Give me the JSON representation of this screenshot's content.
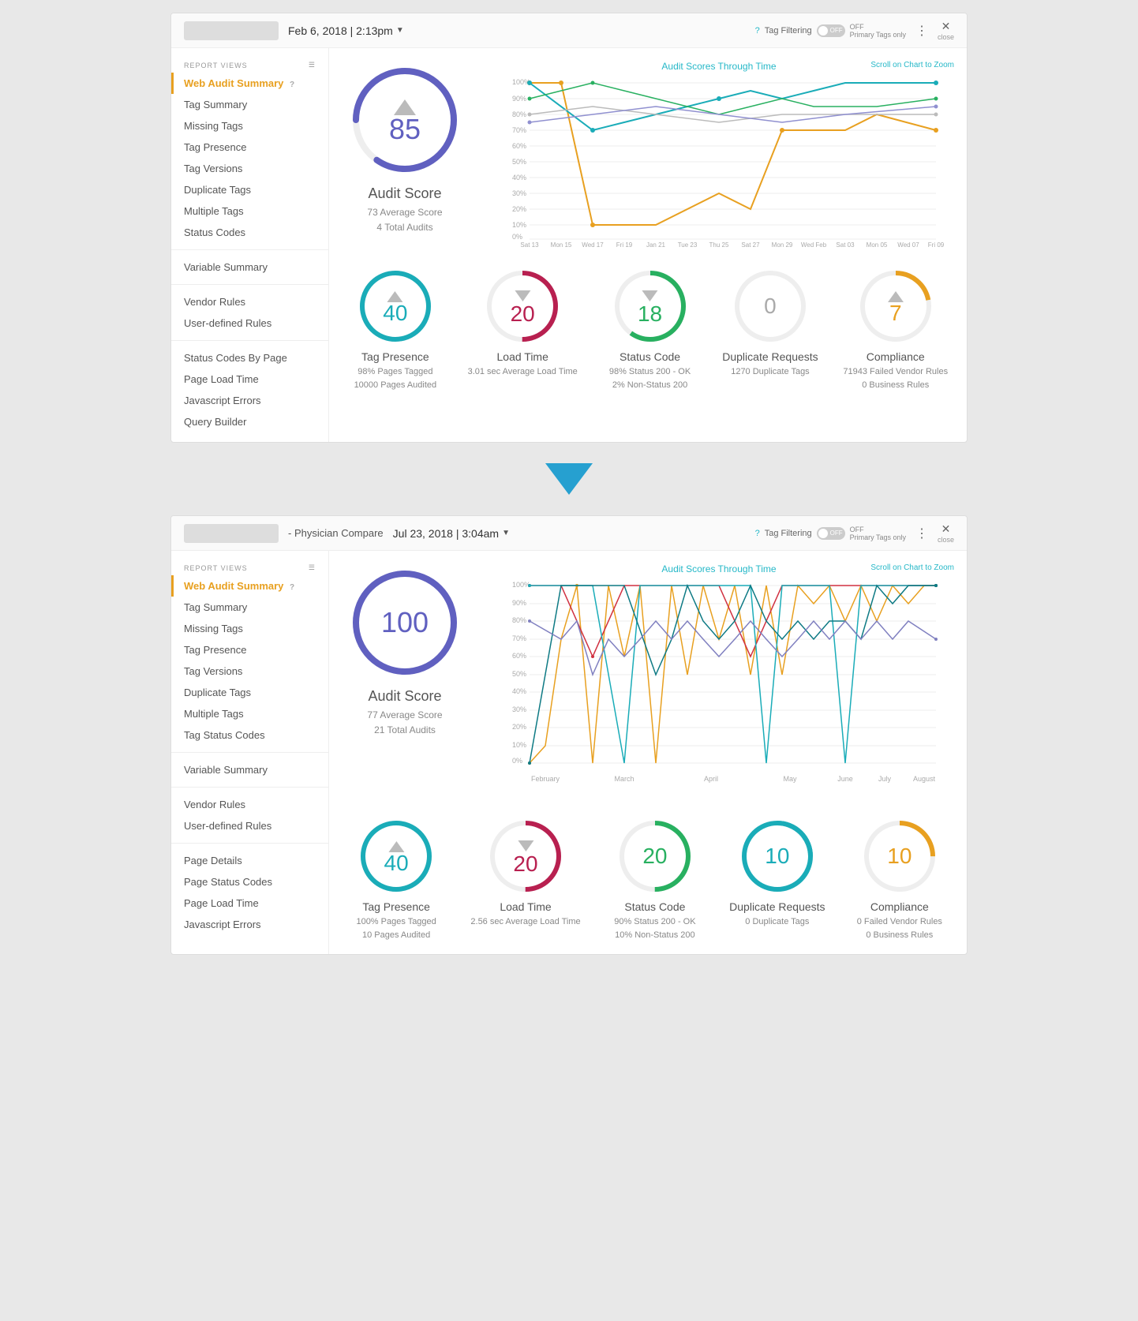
{
  "panel1": {
    "date": "Feb 6, 2018 | 2:13pm",
    "tag_filtering_label": "Tag Filtering",
    "tag_filtering_status": "OFF",
    "tag_filtering_sub": "Primary Tags only",
    "close_label": "close",
    "sidebar": {
      "section_label": "REPORT VIEWS",
      "active_item": "Web Audit Summary",
      "active_item_icon": "?",
      "items": [
        "Tag Summary",
        "Missing Tags",
        "Tag Presence",
        "Tag Versions",
        "Duplicate Tags",
        "Multiple Tags",
        "Status Codes",
        "Variable Summary",
        "Vendor Rules",
        "User-defined Rules",
        "Status Codes By Page",
        "Page Load Time",
        "Javascript Errors",
        "Query Builder"
      ]
    },
    "score": {
      "value": "85",
      "label": "Audit Score",
      "sub1": "73 Average Score",
      "sub2": "4 Total Audits"
    },
    "chart": {
      "title": "Audit Scores Through Time",
      "scroll_hint": "Scroll on Chart to Zoom",
      "x_labels": [
        "Sat 13",
        "Mon 15",
        "Wed 17",
        "Fri 19",
        "Jan 21",
        "Tue 23",
        "Thu 25",
        "Sat 27",
        "Mon 29",
        "Wed February",
        "Sat 03",
        "Mon 05",
        "Wed 07",
        "Fri 09"
      ]
    },
    "metrics": [
      {
        "value": "40",
        "label": "Tag Presence",
        "sub1": "98% Pages Tagged",
        "sub2": "10000 Pages Audited",
        "color": "#1aacb8"
      },
      {
        "value": "20",
        "label": "Load Time",
        "sub1": "3.01 sec Average Load Time",
        "sub2": "",
        "color": "#b82050"
      },
      {
        "value": "18",
        "label": "Status Code",
        "sub1": "98% Status 200 - OK",
        "sub2": "2% Non-Status 200",
        "color": "#28b060"
      },
      {
        "value": "0",
        "label": "Duplicate Requests",
        "sub1": "1270 Duplicate Tags",
        "sub2": "",
        "color": "#ccc"
      },
      {
        "value": "7",
        "label": "Compliance",
        "sub1": "71943 Failed Vendor Rules",
        "sub2": "0 Business Rules",
        "color": "#e8a020"
      }
    ]
  },
  "panel2": {
    "title": "- Physician Compare",
    "date": "Jul 23, 2018 | 3:04am",
    "tag_filtering_label": "Tag Filtering",
    "tag_filtering_status": "OFF",
    "tag_filtering_sub": "Primary Tags only",
    "close_label": "close",
    "sidebar": {
      "section_label": "REPORT VIEWS",
      "active_item": "Web Audit Summary",
      "active_item_icon": "?",
      "items": [
        "Tag Summary",
        "Missing Tags",
        "Tag Presence",
        "Tag Versions",
        "Duplicate Tags",
        "Multiple Tags",
        "Tag Status Codes",
        "Variable Summary",
        "Vendor Rules",
        "User-defined Rules",
        "Page Details",
        "Page Status Codes",
        "Page Load Time",
        "Javascript Errors"
      ]
    },
    "score": {
      "value": "100",
      "label": "Audit Score",
      "sub1": "77 Average Score",
      "sub2": "21 Total Audits"
    },
    "chart": {
      "title": "Audit Scores Through Time",
      "scroll_hint": "Scroll on Chart to Zoom",
      "x_labels": [
        "February",
        "March",
        "April",
        "May",
        "June",
        "July",
        "August"
      ]
    },
    "metrics": [
      {
        "value": "40",
        "label": "Tag Presence",
        "sub1": "100% Pages Tagged",
        "sub2": "10 Pages Audited",
        "color": "#1aacb8"
      },
      {
        "value": "20",
        "label": "Load Time",
        "sub1": "2.56 sec Average Load Time",
        "sub2": "",
        "color": "#b82050"
      },
      {
        "value": "20",
        "label": "Status Code",
        "sub1": "90% Status 200 - OK",
        "sub2": "10% Non-Status 200",
        "color": "#28b060"
      },
      {
        "value": "10",
        "label": "Duplicate Requests",
        "sub1": "0 Duplicate Tags",
        "sub2": "",
        "color": "#1aacb8"
      },
      {
        "value": "10",
        "label": "Compliance",
        "sub1": "0 Failed Vendor Rules",
        "sub2": "0 Business Rules",
        "color": "#e8a020"
      }
    ]
  }
}
